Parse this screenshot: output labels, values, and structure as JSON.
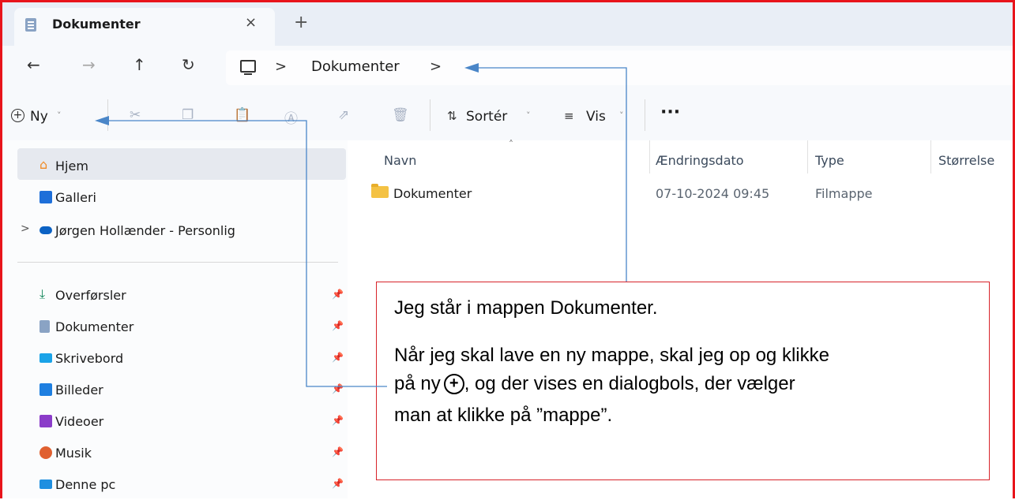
{
  "tab": {
    "title": "Dokumenter",
    "close": "×",
    "new_tab": "+"
  },
  "nav": {
    "back": "←",
    "forward": "→",
    "up": "↑",
    "refresh": "↻"
  },
  "address": {
    "crumb_sep": ">",
    "folder": "Dokumenter",
    "trailing_sep": ">"
  },
  "toolbar": {
    "new_label": "Ny",
    "sort_label": "Sortér",
    "view_label": "Vis",
    "more_label": "···"
  },
  "sidebar": {
    "items": [
      {
        "label": "Hjem",
        "icon": "home-icon",
        "color": "#f08a24"
      },
      {
        "label": "Galleri",
        "icon": "gallery-icon",
        "color": "#1e6fd9"
      },
      {
        "label": "Jørgen Hollænder - Personlig",
        "icon": "onedrive-icon",
        "color": "#0b62c4"
      },
      {
        "label": "Overførsler",
        "icon": "download-icon",
        "color": "#13875b"
      },
      {
        "label": "Dokumenter",
        "icon": "documents-icon",
        "color": "#8aa3c4"
      },
      {
        "label": "Skrivebord",
        "icon": "desktop-icon",
        "color": "#1aa3e8"
      },
      {
        "label": "Billeder",
        "icon": "pictures-icon",
        "color": "#1e7fe0"
      },
      {
        "label": "Videoer",
        "icon": "videos-icon",
        "color": "#8b3cc9"
      },
      {
        "label": "Musik",
        "icon": "music-icon",
        "color": "#e06030"
      },
      {
        "label": "Denne pc",
        "icon": "this-pc-icon",
        "color": "#1f8fe0"
      }
    ],
    "expander": ">"
  },
  "columns": {
    "name": "Navn",
    "date": "Ændringsdato",
    "type": "Type",
    "size": "Størrelse"
  },
  "files": [
    {
      "name": "Dokumenter",
      "date": "07-10-2024 09:45",
      "type": "Filmappe"
    }
  ],
  "annotation": {
    "line1": "Jeg står i mappen Dokumenter.",
    "line2": "Når jeg skal lave en ny mappe, skal jeg op og klikke",
    "line3_a": "på ny",
    "line3_b": ", og der vises en dialogbols, der vælger",
    "line4": "man at klikke på ”mappe”."
  },
  "colors": {
    "frame": "#e8141b",
    "arrow": "#4a86c8",
    "note_border": "#d8232a"
  }
}
